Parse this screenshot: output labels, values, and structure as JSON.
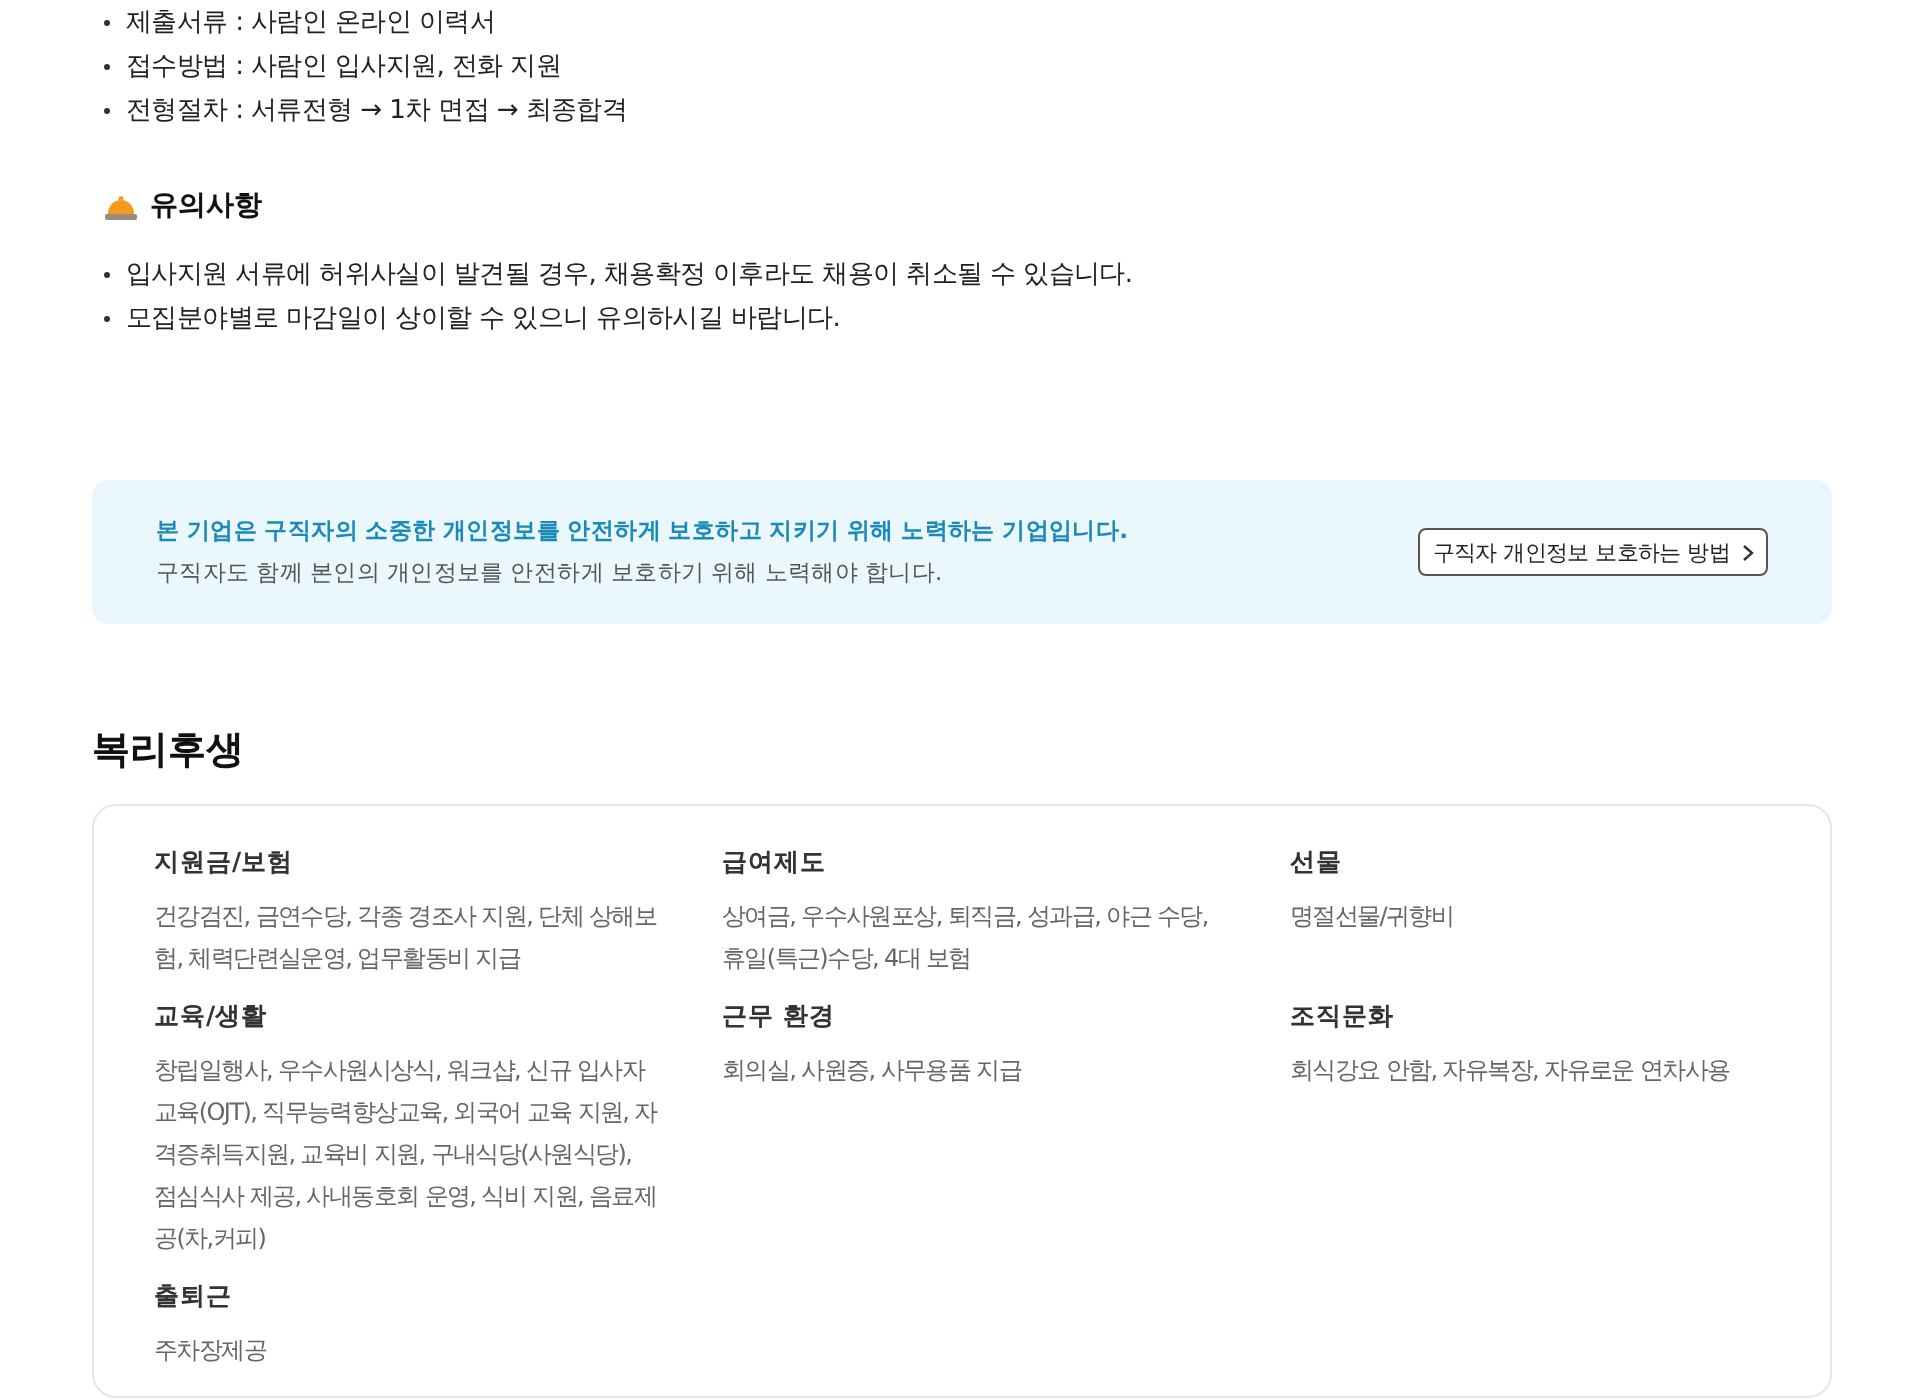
{
  "apply_info": [
    "제출서류 : 사람인 온라인 이력서",
    "접수방법 : 사람인 입사지원, 전화 지원",
    "전형절차 : 서류전형 → 1차 면접 → 최종합격"
  ],
  "notes": {
    "title": "유의사항",
    "items": [
      "입사지원 서류에 허위사실이 발견될 경우, 채용확정 이후라도 채용이 취소될 수 있습니다.",
      "모집분야별로 마감일이 상이할 수 있으니 유의하시길 바랍니다."
    ]
  },
  "privacy_notice": {
    "headline": "본 기업은 구직자의 소중한 개인정보를 안전하게 보호하고 지키기 위해 노력하는 기업입니다.",
    "subtext": "구직자도 함께 본인의 개인정보를 안전하게 보호하기 위해 노력해야 합니다.",
    "button": "구직자 개인정보 보호하는 방법"
  },
  "benefits": {
    "title": "복리후생",
    "groups": [
      {
        "title": "지원금/보험",
        "text": "건강검진, 금연수당, 각종 경조사 지원, 단체 상해보험, 체력단련실운영, 업무활동비 지급"
      },
      {
        "title": "급여제도",
        "text": "상여금, 우수사원포상, 퇴직금, 성과급, 야근 수당, 휴일(특근)수당, 4대 보험"
      },
      {
        "title": "선물",
        "text": "명절선물/귀향비"
      },
      {
        "title": "교육/생활",
        "text": "창립일행사, 우수사원시상식, 워크샵, 신규 입사자 교육(OJT), 직무능력향상교육, 외국어 교육 지원, 자격증취득지원, 교육비 지원, 구내식당(사원식당), 점심식사 제공, 사내동호회 운영, 식비 지원, 음료제공(차,커피)"
      },
      {
        "title": "근무 환경",
        "text": "회의실, 사원증, 사무용품 지급"
      },
      {
        "title": "조직문화",
        "text": "회식강요 안함, 자유복장, 자유로운 연차사용"
      },
      {
        "title": "출퇴근",
        "text": "주차장제공"
      }
    ]
  }
}
